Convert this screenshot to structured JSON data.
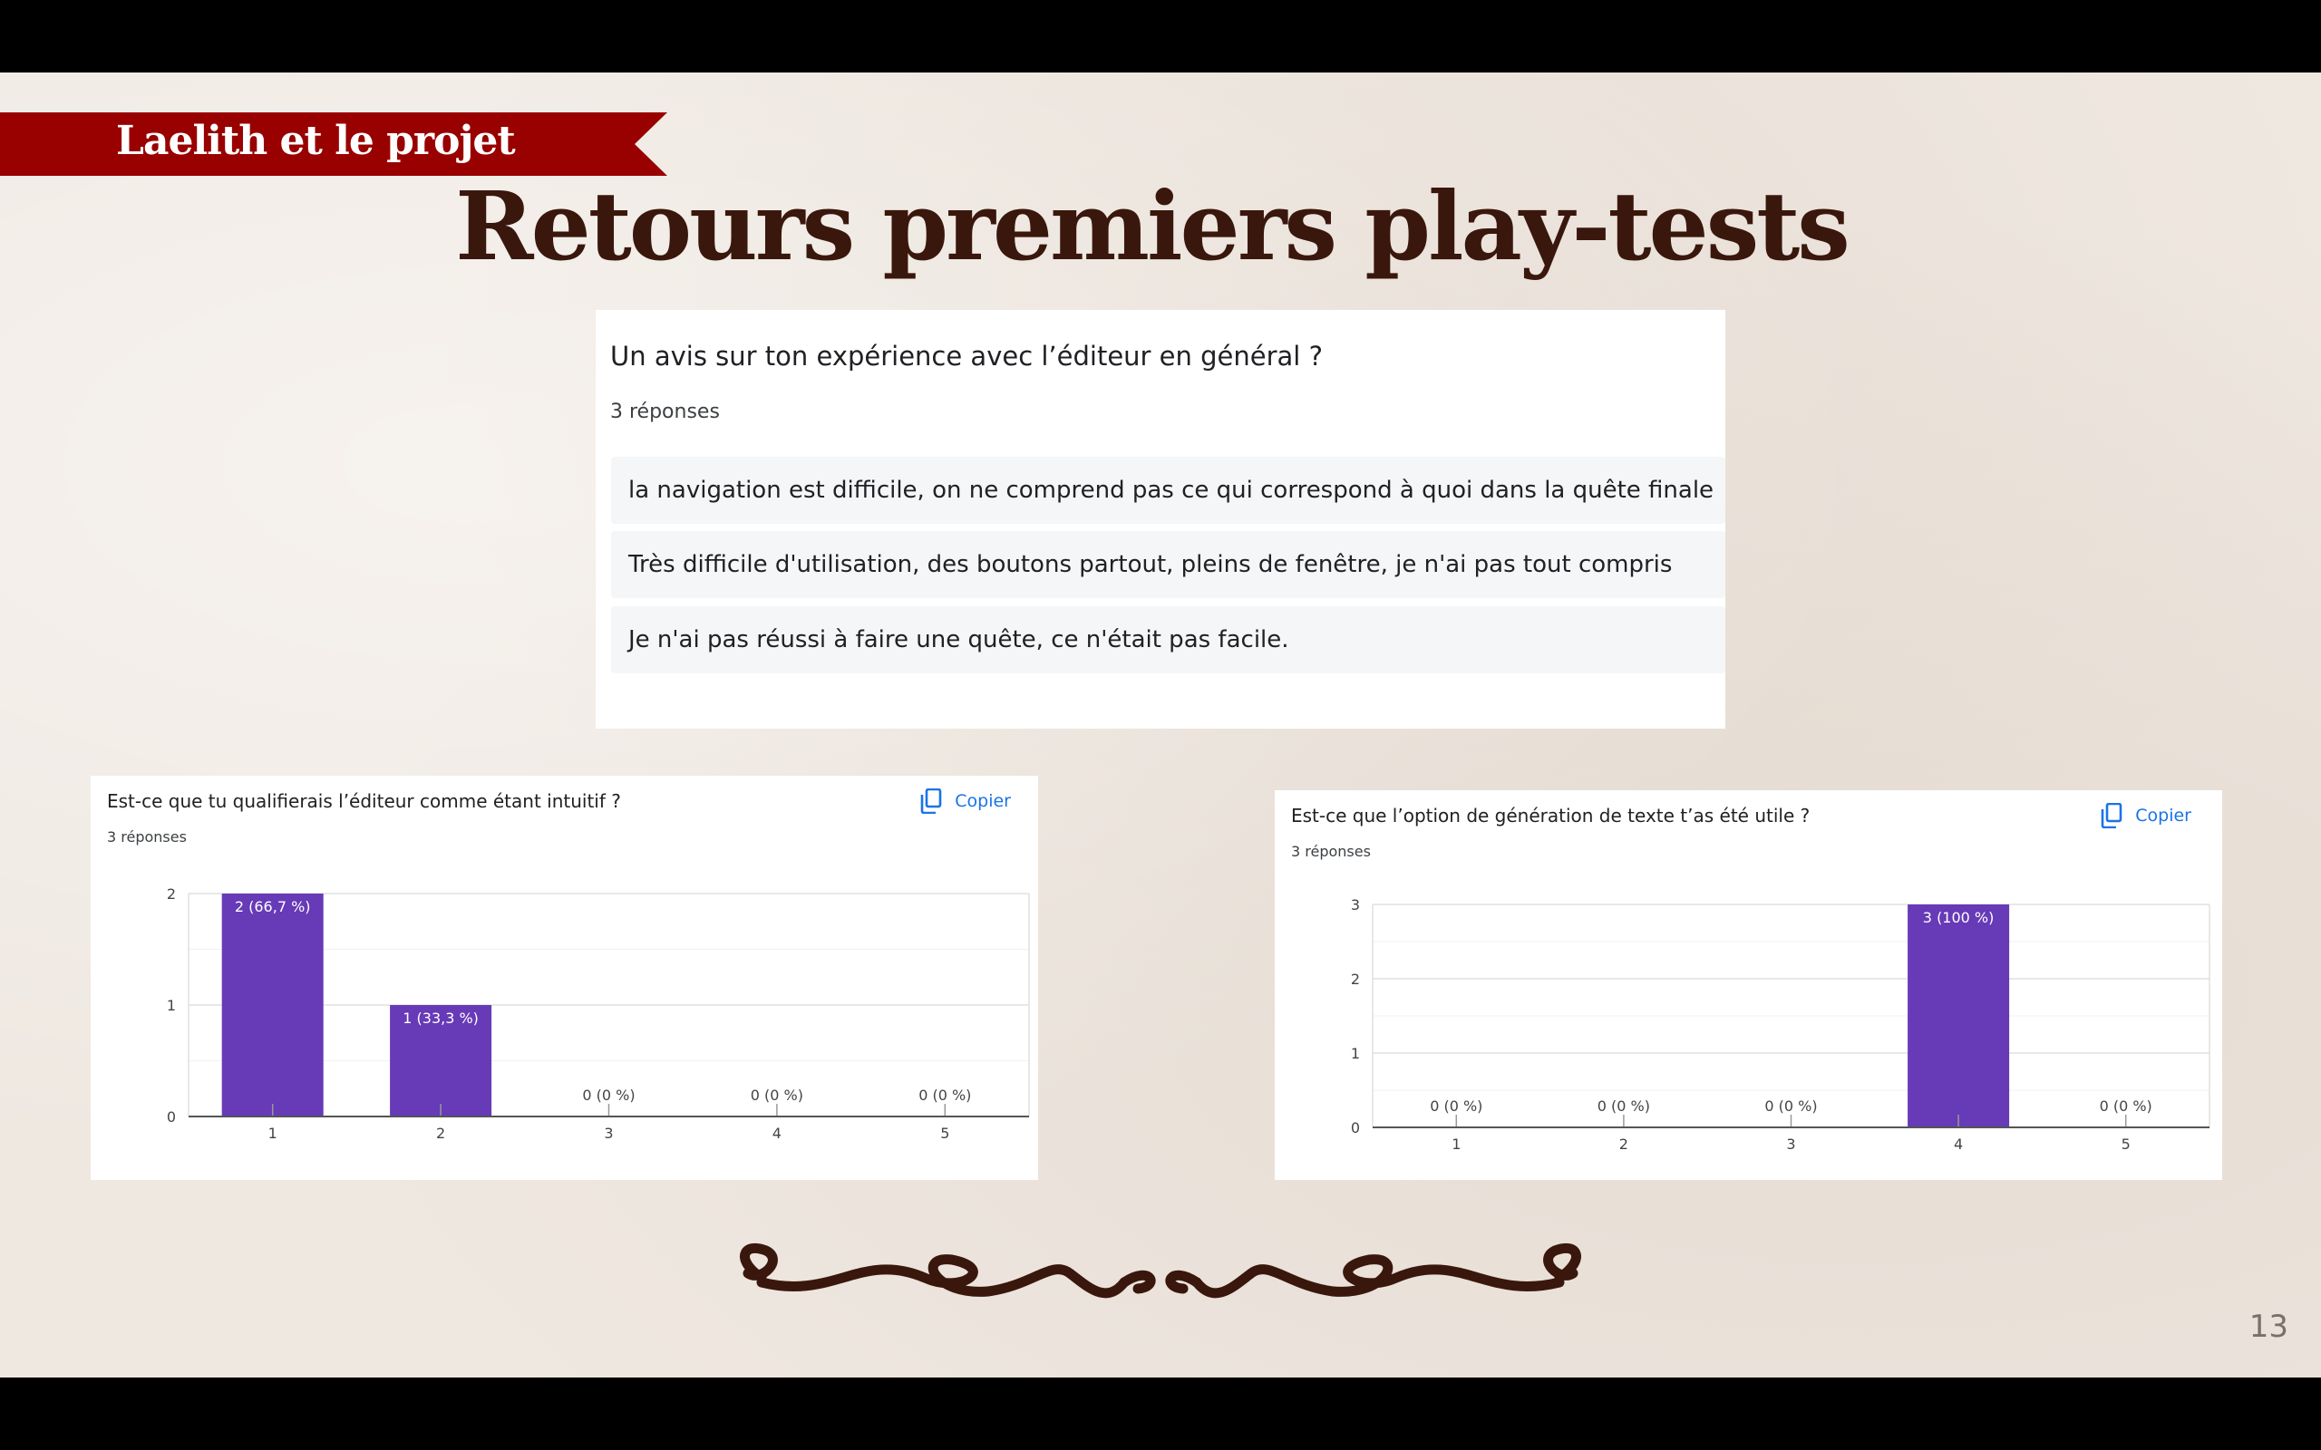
{
  "section_label": "Laelith et le projet",
  "title": "Retours premiers play-tests",
  "text_question": {
    "title": "Un avis sur ton expérience avec l’éditeur en général ?",
    "count": "3 réponses",
    "answers": [
      "la navigation est difficile, on ne comprend pas ce qui correspond à quoi dans la quête finale",
      "Très difficile d'utilisation, des boutons partout, pleins de fenêtre, je n'ai pas tout compris",
      "Je n'ai pas réussi à faire une quête, ce n'était pas facile."
    ]
  },
  "copy_label": "Copier",
  "page_number": "13",
  "colors": {
    "bar": "#673ab7",
    "ribbon": "#990000",
    "title": "#3a170c",
    "copy": "#1a73e8"
  },
  "chart_data": [
    {
      "type": "bar",
      "title": "Est-ce que tu qualifierais l’éditeur comme étant intuitif ?",
      "count": "3 réponses",
      "categories": [
        "1",
        "2",
        "3",
        "4",
        "5"
      ],
      "values": [
        2,
        1,
        0,
        0,
        0
      ],
      "data_labels": [
        "2 (66,7 %)",
        "1 (33,3 %)",
        "0 (0 %)",
        "0 (0 %)",
        "0 (0 %)"
      ],
      "yticks": [
        "0",
        "1",
        "2"
      ],
      "ylim": [
        0,
        2
      ],
      "grid": true
    },
    {
      "type": "bar",
      "title": "Est-ce que l’option de génération de texte t’as été utile ?",
      "count": "3 réponses",
      "categories": [
        "1",
        "2",
        "3",
        "4",
        "5"
      ],
      "values": [
        0,
        0,
        0,
        3,
        0
      ],
      "data_labels": [
        "0 (0 %)",
        "0 (0 %)",
        "0 (0 %)",
        "3 (100 %)",
        "0 (0 %)"
      ],
      "yticks": [
        "0",
        "1",
        "2",
        "3"
      ],
      "ylim": [
        0,
        3
      ],
      "grid": true
    }
  ]
}
